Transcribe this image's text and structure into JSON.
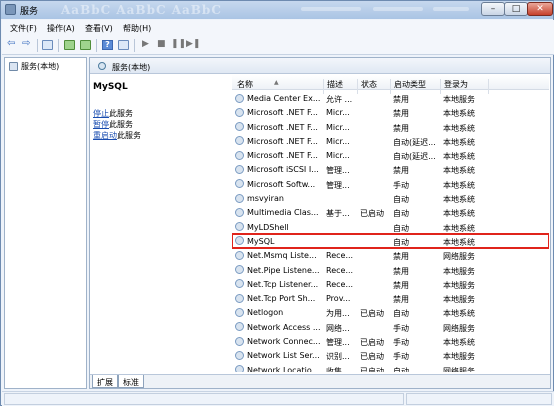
{
  "window": {
    "title": "服务",
    "faded_title": "AaBbC AaBbC AaBbC"
  },
  "menu": [
    "文件(F)",
    "操作(A)",
    "查看(V)",
    "帮助(H)"
  ],
  "toolbar": {
    "back": "⇦",
    "forward": "⇨",
    "help": "?",
    "start": "▶",
    "stop": "■",
    "pause": "❚❚",
    "restart": "▶❚"
  },
  "left_pane": {
    "tree_item": "服务(本地)"
  },
  "right_pane": {
    "header": "服务(本地)",
    "desc": {
      "service_name": "MySQL",
      "stop_link": "停止",
      "stop_suffix": "此服务",
      "pause_link": "暂停",
      "pause_suffix": "此服务",
      "restart_link": "重启动",
      "restart_suffix": "此服务"
    }
  },
  "columns": {
    "name": "名称",
    "desc": "描述",
    "status": "状态",
    "startup": "启动类型",
    "logon": "登录为"
  },
  "services": [
    {
      "name": "Media Center Ex...",
      "desc": "允许 ...",
      "status": "",
      "startup": "禁用",
      "logon": "本地服务"
    },
    {
      "name": "Microsoft .NET F...",
      "desc": "Micr...",
      "status": "",
      "startup": "禁用",
      "logon": "本地系统"
    },
    {
      "name": "Microsoft .NET F...",
      "desc": "Micr...",
      "status": "",
      "startup": "禁用",
      "logon": "本地系统"
    },
    {
      "name": "Microsoft .NET F...",
      "desc": "Micr...",
      "status": "",
      "startup": "自动(延迟...",
      "logon": "本地系统"
    },
    {
      "name": "Microsoft .NET F...",
      "desc": "Micr...",
      "status": "",
      "startup": "自动(延迟...",
      "logon": "本地系统"
    },
    {
      "name": "Microsoft iSCSI I...",
      "desc": "管理...",
      "status": "",
      "startup": "禁用",
      "logon": "本地系统"
    },
    {
      "name": "Microsoft Softw...",
      "desc": "管理...",
      "status": "",
      "startup": "手动",
      "logon": "本地系统"
    },
    {
      "name": "msvyiran",
      "desc": "",
      "status": "",
      "startup": "自动",
      "logon": "本地系统"
    },
    {
      "name": "Multimedia Clas...",
      "desc": "基于...",
      "status": "已启动",
      "startup": "自动",
      "logon": "本地系统"
    },
    {
      "name": "MyLDShell",
      "desc": "",
      "status": "",
      "startup": "自动",
      "logon": "本地系统"
    },
    {
      "name": "MySQL",
      "desc": "",
      "status": "",
      "startup": "自动",
      "logon": "本地系统",
      "selected": true
    },
    {
      "name": "Net.Msmq Liste...",
      "desc": "Rece...",
      "status": "",
      "startup": "禁用",
      "logon": "网络服务"
    },
    {
      "name": "Net.Pipe Listene...",
      "desc": "Rece...",
      "status": "",
      "startup": "禁用",
      "logon": "本地服务"
    },
    {
      "name": "Net.Tcp Listener...",
      "desc": "Rece...",
      "status": "",
      "startup": "禁用",
      "logon": "本地服务"
    },
    {
      "name": "Net.Tcp Port Sh...",
      "desc": "Prov...",
      "status": "",
      "startup": "禁用",
      "logon": "本地服务"
    },
    {
      "name": "Netlogon",
      "desc": "为用...",
      "status": "已启动",
      "startup": "自动",
      "logon": "本地系统"
    },
    {
      "name": "Network Access ...",
      "desc": "网络...",
      "status": "",
      "startup": "手动",
      "logon": "网络服务"
    },
    {
      "name": "Network Connec...",
      "desc": "管理...",
      "status": "已启动",
      "startup": "手动",
      "logon": "本地系统"
    },
    {
      "name": "Network List Ser...",
      "desc": "识别...",
      "status": "已启动",
      "startup": "手动",
      "logon": "本地服务"
    },
    {
      "name": "Network Locatio...",
      "desc": "收集...",
      "status": "已启动",
      "startup": "自动",
      "logon": "网络服务"
    }
  ],
  "tabs": {
    "extended": "扩展",
    "standard": "标准"
  }
}
